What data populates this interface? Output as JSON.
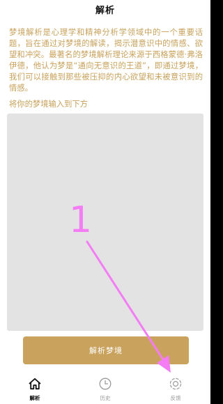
{
  "header": {
    "title": "解析"
  },
  "main": {
    "intro": "梦境解析是心理学和精神分析学领域中的一个重要话题，旨在通过对梦境的解读，揭示潜意识中的情感、欲望和冲突。最著名的梦境解析理论来源于西格蒙德·弗洛伊德，他认为梦是“通向无意识的王道”，即通过梦境，我们可以接触到那些被压抑的内心欲望和未被意识到的情感。",
    "prompt": "将你的梦境输入到下方",
    "input_value": "",
    "input_placeholder": "",
    "analyze_button": "解析梦境"
  },
  "tabbar": {
    "tabs": [
      {
        "label": "解析",
        "icon": "home-icon",
        "active": true
      },
      {
        "label": "历史",
        "icon": "clock-icon",
        "active": false
      },
      {
        "label": "反馈",
        "icon": "settings-icon",
        "active": false
      }
    ]
  },
  "annotation": {
    "step_label": "1",
    "color": "#f47df5"
  },
  "colors": {
    "accent": "#c9a25d",
    "text_gold": "#c8a15b",
    "input_bg": "#e3e3e3",
    "inactive_tab": "#999999"
  }
}
